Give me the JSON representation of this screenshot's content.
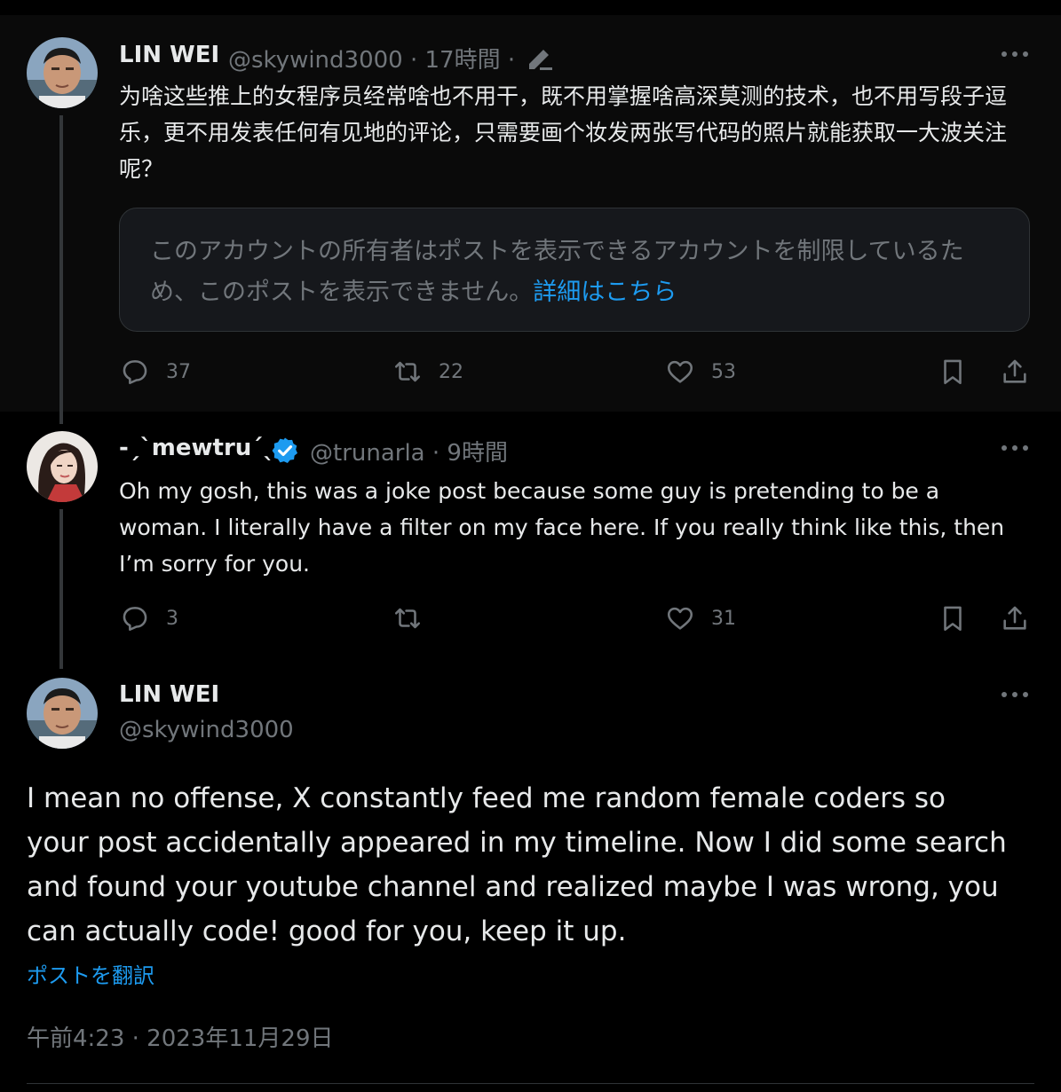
{
  "post1": {
    "name": "LIN WEI",
    "handle": "@skywind3000 · 17時間 ·",
    "text": "为啥这些推上的女程序员经常啥也不用干，既不用掌握啥高深莫测的技术，也不用写段子逗乐，更不用发表任何有见地的评论，只需要画个妆发两张写代码的照片就能获取一大波关注呢？",
    "notice_text": "このアカウントの所有者はポストを表示できるアカウントを制限しているため、このポストを表示できません。",
    "notice_link": "詳細はこちら",
    "replies": "37",
    "reposts": "22",
    "likes": "53"
  },
  "post2": {
    "name": "-ˏˋmewtruˊˎ-",
    "handle": "@trunarla · 9時間",
    "text": "Oh my gosh, this was a joke post because some guy is pretending to be a woman. I literally have a filter on my face here. If you really think like this, then I’m sorry for you.",
    "replies": "3",
    "reposts": "",
    "likes": "31"
  },
  "post3": {
    "name": "LIN WEI",
    "handle": "@skywind3000",
    "text": "I mean no offense, X constantly feed me random female coders so your post accidentally appeared in my timeline. Now I did some search and found your youtube channel and realized maybe I was wrong, you can actually code! good for you, keep it up.",
    "translate": "ポストを翻訳",
    "timestamp": "午前4:23 · 2023年11月29日"
  },
  "colors": {
    "background": "#000000",
    "text": "#e7e9ea",
    "secondary": "#71767b",
    "accent": "#1d9bf0",
    "verified": "#1d9bf0"
  },
  "icons": [
    "reply-icon",
    "repost-icon",
    "like-icon",
    "bookmark-icon",
    "share-icon",
    "more-icon",
    "edit-icon",
    "verified-badge-icon"
  ]
}
